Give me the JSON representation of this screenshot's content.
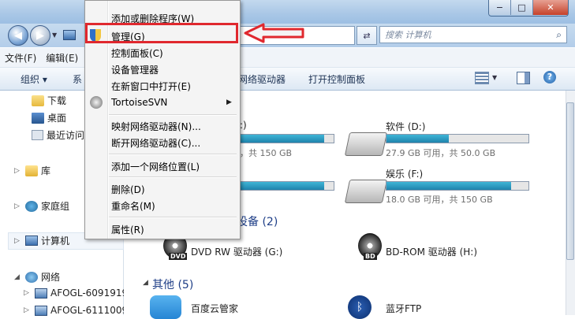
{
  "window": {
    "min": "−",
    "max": "□",
    "close": "✕"
  },
  "address": {
    "search_placeholder": "搜索 计算机"
  },
  "menubar": [
    "文件(F)",
    "编辑(E)"
  ],
  "toolbar": {
    "organize": "组织 ▾",
    "system_partial": "系",
    "map_drive": "网络驱动器",
    "open_cp": "打开控制面板"
  },
  "nav": {
    "downloads": "下载",
    "desktop": "桌面",
    "recent": "最近访问",
    "library": "库",
    "homegroup": "家庭组",
    "computer": "计算机",
    "network": "网络",
    "hosts": [
      "AFOGL-60919191",
      "AFOGL-61110095"
    ]
  },
  "drives": {
    "c_partial": ":)",
    "c_free": "，共 150 GB",
    "d_name": "软件 (D:)",
    "d_free": "27.9 GB 可用，共 50.0 GB",
    "d_fill": 0.44,
    "f_name": "娱乐 (F:)",
    "f_free": "18.0 GB 可用，共 150 GB",
    "f_fill": 0.88,
    "e_fill": 0.9,
    "c_fill": 0.9
  },
  "sections": {
    "removable": "设备 (2)",
    "other": "其他 (5)"
  },
  "removable": {
    "dvd": "DVD RW 驱动器 (G:)",
    "dvd_badge": "DVD",
    "bd": "BD-ROM 驱动器 (H:)",
    "bd_badge": "BD"
  },
  "other": {
    "baidu": "百度云管家",
    "bt": "蓝牙FTP"
  },
  "context_menu": {
    "items": [
      "添加或删除程序(W)",
      "管理(G)",
      "控制面板(C)",
      "设备管理器",
      "在新窗口中打开(E)",
      "TortoiseSVN",
      "映射网络驱动器(N)...",
      "断开网络驱动器(C)...",
      "添加一个网络位置(L)",
      "删除(D)",
      "重命名(M)",
      "属性(R)"
    ]
  },
  "colors": {
    "highlight": "#e0282e",
    "bar": "#1f84ad"
  }
}
